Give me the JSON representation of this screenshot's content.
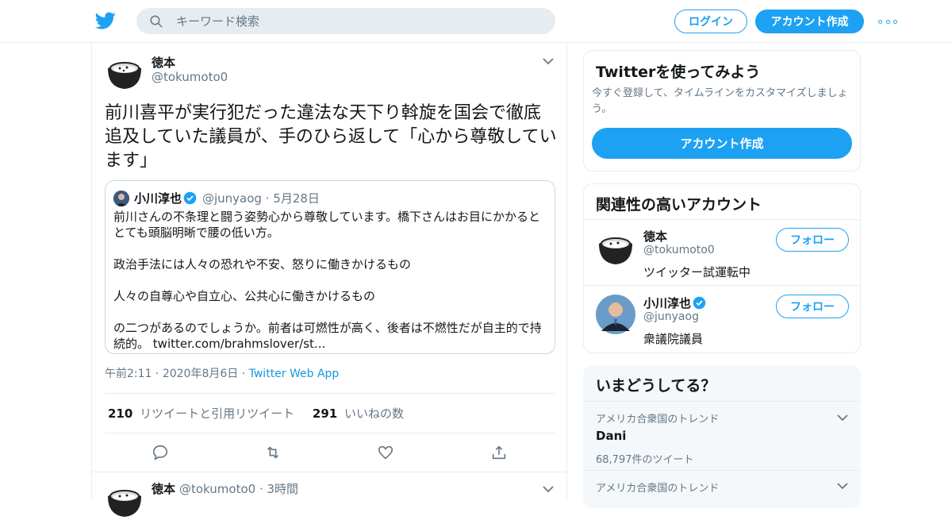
{
  "colors": {
    "accent": "#1da1f2",
    "text": "#14171a",
    "muted": "#657786",
    "border": "#e6ecf0"
  },
  "header": {
    "search_placeholder": "キーワード検索",
    "login_label": "ログイン",
    "signup_label": "アカウント作成"
  },
  "tweet": {
    "author_name": "徳本",
    "author_handle": "@tokumoto0",
    "text": "前川喜平が実行犯だった違法な天下り斡旋を国会で徹底追及していた議員が、手のひら返して「心から尊敬しています」",
    "quote": {
      "name": "小川淳也",
      "handle": "@junyaog",
      "date": "5月28日",
      "body": "前川さんの不条理と闘う姿勢心から尊敬しています。橋下さんはお目にかかるととても頭脳明晰で腰の低い方。\n\n政治手法には人々の恐れや不安、怒りに働きかけるもの\n\n人々の自尊心や自立心、公共心に働きかけるもの\n\nの二つがあるのでしょうか。前者は可燃性が高く、後者は不燃性だが自主的で持続的。",
      "link": "twitter.com/brahmslover/st..."
    },
    "time": "午前2:11",
    "date": "2020年8月6日",
    "app": "Twitter Web App",
    "retweets": "210",
    "retweets_label": "リツイートと引用リツイート",
    "likes": "291",
    "likes_label": "いいねの数"
  },
  "next_tweet": {
    "author_name": "徳本",
    "author_handle": "@tokumoto0",
    "time": "3時間"
  },
  "sidebar": {
    "signup_card": {
      "title": "Twitterを使ってみよう",
      "subtitle": "今すぐ登録して、タイムラインをカスタマイズしましょう。",
      "button": "アカウント作成"
    },
    "relevant": {
      "title": "関連性の高いアカウント",
      "accounts": [
        {
          "name": "徳本",
          "handle": "@tokumoto0",
          "bio": "ツイッター試運転中",
          "follow": "フォロー"
        },
        {
          "name": "小川淳也",
          "handle": "@junyaog",
          "bio": "衆議院議員",
          "follow": "フォロー"
        }
      ]
    },
    "trends": {
      "title": "いまどうしてる？",
      "items": [
        {
          "context": "アメリカ合衆国のトレンド",
          "topic": "Dani",
          "count": "68,797件のツイート"
        },
        {
          "context": "アメリカ合衆国のトレンド",
          "topic": "",
          "count": ""
        }
      ]
    }
  },
  "icons": [
    "twitter-logo-icon",
    "search-icon",
    "more-icon",
    "chevron-down-icon",
    "verified-icon",
    "reply-icon",
    "retweet-icon",
    "like-icon",
    "share-icon"
  ]
}
